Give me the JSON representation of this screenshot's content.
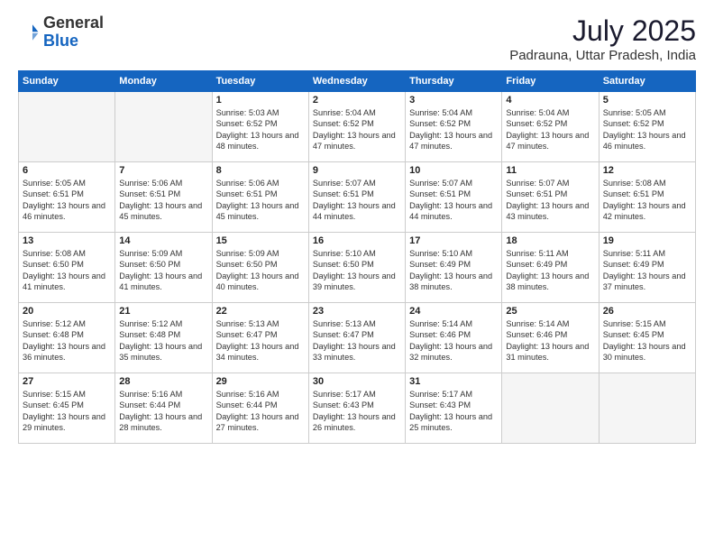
{
  "header": {
    "logo_general": "General",
    "logo_blue": "Blue",
    "month_year": "July 2025",
    "location": "Padrauna, Uttar Pradesh, India"
  },
  "days_of_week": [
    "Sunday",
    "Monday",
    "Tuesday",
    "Wednesday",
    "Thursday",
    "Friday",
    "Saturday"
  ],
  "weeks": [
    [
      {
        "day": "",
        "info": ""
      },
      {
        "day": "",
        "info": ""
      },
      {
        "day": "1",
        "info": "Sunrise: 5:03 AM\nSunset: 6:52 PM\nDaylight: 13 hours and 48 minutes."
      },
      {
        "day": "2",
        "info": "Sunrise: 5:04 AM\nSunset: 6:52 PM\nDaylight: 13 hours and 47 minutes."
      },
      {
        "day": "3",
        "info": "Sunrise: 5:04 AM\nSunset: 6:52 PM\nDaylight: 13 hours and 47 minutes."
      },
      {
        "day": "4",
        "info": "Sunrise: 5:04 AM\nSunset: 6:52 PM\nDaylight: 13 hours and 47 minutes."
      },
      {
        "day": "5",
        "info": "Sunrise: 5:05 AM\nSunset: 6:52 PM\nDaylight: 13 hours and 46 minutes."
      }
    ],
    [
      {
        "day": "6",
        "info": "Sunrise: 5:05 AM\nSunset: 6:51 PM\nDaylight: 13 hours and 46 minutes."
      },
      {
        "day": "7",
        "info": "Sunrise: 5:06 AM\nSunset: 6:51 PM\nDaylight: 13 hours and 45 minutes."
      },
      {
        "day": "8",
        "info": "Sunrise: 5:06 AM\nSunset: 6:51 PM\nDaylight: 13 hours and 45 minutes."
      },
      {
        "day": "9",
        "info": "Sunrise: 5:07 AM\nSunset: 6:51 PM\nDaylight: 13 hours and 44 minutes."
      },
      {
        "day": "10",
        "info": "Sunrise: 5:07 AM\nSunset: 6:51 PM\nDaylight: 13 hours and 44 minutes."
      },
      {
        "day": "11",
        "info": "Sunrise: 5:07 AM\nSunset: 6:51 PM\nDaylight: 13 hours and 43 minutes."
      },
      {
        "day": "12",
        "info": "Sunrise: 5:08 AM\nSunset: 6:51 PM\nDaylight: 13 hours and 42 minutes."
      }
    ],
    [
      {
        "day": "13",
        "info": "Sunrise: 5:08 AM\nSunset: 6:50 PM\nDaylight: 13 hours and 41 minutes."
      },
      {
        "day": "14",
        "info": "Sunrise: 5:09 AM\nSunset: 6:50 PM\nDaylight: 13 hours and 41 minutes."
      },
      {
        "day": "15",
        "info": "Sunrise: 5:09 AM\nSunset: 6:50 PM\nDaylight: 13 hours and 40 minutes."
      },
      {
        "day": "16",
        "info": "Sunrise: 5:10 AM\nSunset: 6:50 PM\nDaylight: 13 hours and 39 minutes."
      },
      {
        "day": "17",
        "info": "Sunrise: 5:10 AM\nSunset: 6:49 PM\nDaylight: 13 hours and 38 minutes."
      },
      {
        "day": "18",
        "info": "Sunrise: 5:11 AM\nSunset: 6:49 PM\nDaylight: 13 hours and 38 minutes."
      },
      {
        "day": "19",
        "info": "Sunrise: 5:11 AM\nSunset: 6:49 PM\nDaylight: 13 hours and 37 minutes."
      }
    ],
    [
      {
        "day": "20",
        "info": "Sunrise: 5:12 AM\nSunset: 6:48 PM\nDaylight: 13 hours and 36 minutes."
      },
      {
        "day": "21",
        "info": "Sunrise: 5:12 AM\nSunset: 6:48 PM\nDaylight: 13 hours and 35 minutes."
      },
      {
        "day": "22",
        "info": "Sunrise: 5:13 AM\nSunset: 6:47 PM\nDaylight: 13 hours and 34 minutes."
      },
      {
        "day": "23",
        "info": "Sunrise: 5:13 AM\nSunset: 6:47 PM\nDaylight: 13 hours and 33 minutes."
      },
      {
        "day": "24",
        "info": "Sunrise: 5:14 AM\nSunset: 6:46 PM\nDaylight: 13 hours and 32 minutes."
      },
      {
        "day": "25",
        "info": "Sunrise: 5:14 AM\nSunset: 6:46 PM\nDaylight: 13 hours and 31 minutes."
      },
      {
        "day": "26",
        "info": "Sunrise: 5:15 AM\nSunset: 6:45 PM\nDaylight: 13 hours and 30 minutes."
      }
    ],
    [
      {
        "day": "27",
        "info": "Sunrise: 5:15 AM\nSunset: 6:45 PM\nDaylight: 13 hours and 29 minutes."
      },
      {
        "day": "28",
        "info": "Sunrise: 5:16 AM\nSunset: 6:44 PM\nDaylight: 13 hours and 28 minutes."
      },
      {
        "day": "29",
        "info": "Sunrise: 5:16 AM\nSunset: 6:44 PM\nDaylight: 13 hours and 27 minutes."
      },
      {
        "day": "30",
        "info": "Sunrise: 5:17 AM\nSunset: 6:43 PM\nDaylight: 13 hours and 26 minutes."
      },
      {
        "day": "31",
        "info": "Sunrise: 5:17 AM\nSunset: 6:43 PM\nDaylight: 13 hours and 25 minutes."
      },
      {
        "day": "",
        "info": ""
      },
      {
        "day": "",
        "info": ""
      }
    ]
  ]
}
